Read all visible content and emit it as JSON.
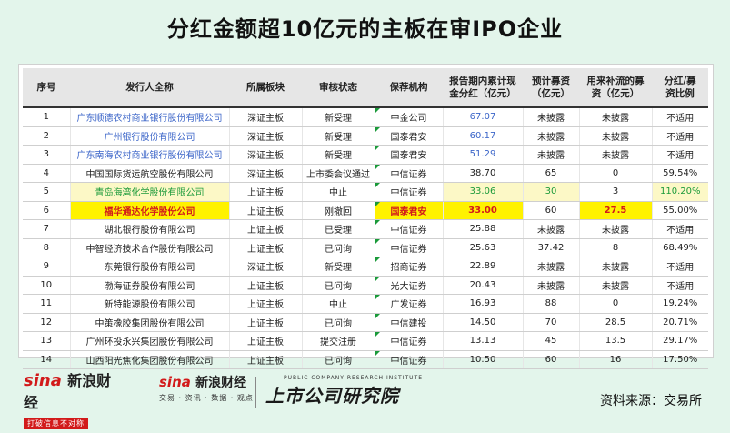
{
  "title": "分红金额超10亿元的主板在审IPO企业",
  "columns": [
    "序号",
    "发行人全称",
    "所属板块",
    "审核状态",
    "保荐机构",
    "报告期内累计现\n金分红（亿元）",
    "预计募资\n（亿元）",
    "用来补流的募\n资（亿元）",
    "分红/募\n资比例"
  ],
  "rows": [
    {
      "no": "1",
      "name": "广东顺德农村商业银行股份有限公司",
      "board": "深证主板",
      "status": "新受理",
      "sponsor": "中金公司",
      "dividend": "67.07",
      "raise": "未披露",
      "supplement": "未披露",
      "ratio": "不适用"
    },
    {
      "no": "2",
      "name": "广州银行股份有限公司",
      "board": "深证主板",
      "status": "新受理",
      "sponsor": "国泰君安",
      "dividend": "60.17",
      "raise": "未披露",
      "supplement": "未披露",
      "ratio": "不适用"
    },
    {
      "no": "3",
      "name": "广东南海农村商业银行股份有限公司",
      "board": "深证主板",
      "status": "新受理",
      "sponsor": "国泰君安",
      "dividend": "51.29",
      "raise": "未披露",
      "supplement": "未披露",
      "ratio": "不适用"
    },
    {
      "no": "4",
      "name": "中国国际货运航空股份有限公司",
      "board": "深证主板",
      "status": "上市委会议通过",
      "sponsor": "中信证券",
      "dividend": "38.70",
      "raise": "65",
      "supplement": "0",
      "ratio": "59.54%"
    },
    {
      "no": "5",
      "name": "青岛海湾化学股份有限公司",
      "board": "上证主板",
      "status": "中止",
      "sponsor": "中信证券",
      "dividend": "33.06",
      "raise": "30",
      "supplement": "3",
      "ratio": "110.20%"
    },
    {
      "no": "6",
      "name": "福华通达化学股份公司",
      "board": "上证主板",
      "status": "刚撤回",
      "sponsor": "国泰君安",
      "dividend": "33.00",
      "raise": "60",
      "supplement": "27.5",
      "ratio": "55.00%"
    },
    {
      "no": "7",
      "name": "湖北银行股份有限公司",
      "board": "上证主板",
      "status": "已受理",
      "sponsor": "中信证券",
      "dividend": "25.88",
      "raise": "未披露",
      "supplement": "未披露",
      "ratio": "不适用"
    },
    {
      "no": "8",
      "name": "中智经济技术合作股份有限公司",
      "board": "上证主板",
      "status": "已问询",
      "sponsor": "中信证券",
      "dividend": "25.63",
      "raise": "37.42",
      "supplement": "8",
      "ratio": "68.49%"
    },
    {
      "no": "9",
      "name": "东莞银行股份有限公司",
      "board": "深证主板",
      "status": "新受理",
      "sponsor": "招商证券",
      "dividend": "22.89",
      "raise": "未披露",
      "supplement": "未披露",
      "ratio": "不适用"
    },
    {
      "no": "10",
      "name": "渤海证券股份有限公司",
      "board": "上证主板",
      "status": "已问询",
      "sponsor": "光大证券",
      "dividend": "20.43",
      "raise": "未披露",
      "supplement": "未披露",
      "ratio": "不适用"
    },
    {
      "no": "11",
      "name": "新特能源股份有限公司",
      "board": "上证主板",
      "status": "中止",
      "sponsor": "广发证券",
      "dividend": "16.93",
      "raise": "88",
      "supplement": "0",
      "ratio": "19.24%"
    },
    {
      "no": "12",
      "name": "中策橡胶集团股份有限公司",
      "board": "上证主板",
      "status": "已问询",
      "sponsor": "中信建投",
      "dividend": "14.50",
      "raise": "70",
      "supplement": "28.5",
      "ratio": "20.71%"
    },
    {
      "no": "13",
      "name": "广州环投永兴集团股份有限公司",
      "board": "上证主板",
      "status": "提交注册",
      "sponsor": "中信证券",
      "dividend": "13.13",
      "raise": "45",
      "supplement": "13.5",
      "ratio": "29.17%"
    },
    {
      "no": "14",
      "name": "山西阳光焦化集团股份有限公司",
      "board": "上证主板",
      "status": "已问询",
      "sponsor": "中信证券",
      "dividend": "10.50",
      "raise": "60",
      "supplement": "16",
      "ratio": "17.50%"
    }
  ],
  "footer": {
    "logo1_brand": "sina",
    "logo1_cn": "新浪财经",
    "logo1_slogan": "打破信息不对称",
    "logo2_brand": "sina",
    "logo2_cn": "新浪财经",
    "logo2_sub": "交易 · 资讯 · 数据 · 观点",
    "logo3_en": "PUBLIC COMPANY RESEARCH INSTITUTE",
    "logo3_cn": "上市公司研究院",
    "source": "资料来源：交易所"
  },
  "colors": {
    "background": "#e3f5eb",
    "blue_text": "#3a64c8",
    "red_text": "#d21a1a",
    "green_text": "#1c9a3a",
    "highlight_yellow": "#fff200",
    "highlight_light": "#fcf8c6"
  }
}
